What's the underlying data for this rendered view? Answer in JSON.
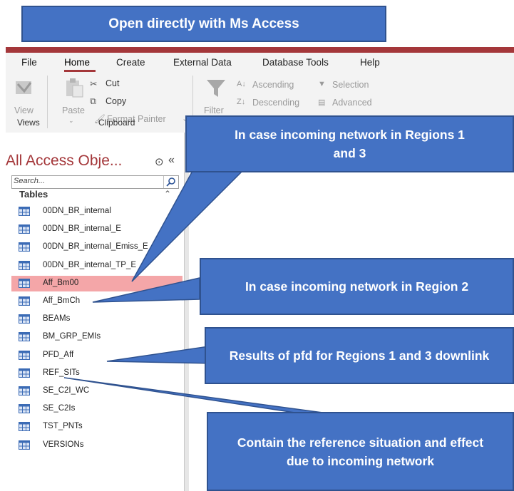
{
  "header_callout": "Open directly with Ms Access",
  "menu": [
    "File",
    "Home",
    "Create",
    "External Data",
    "Database Tools",
    "Help"
  ],
  "ribbon": {
    "view": "View",
    "paste": "Paste",
    "cut": "Cut",
    "copy": "Copy",
    "format_painter": "Format Painter",
    "filter": "Filter",
    "ascending": "Ascending",
    "descending": "Descending",
    "selection": "Selection",
    "advanced": "Advanced",
    "group_views": "Views",
    "group_clipboard": "Clipboard"
  },
  "nav": {
    "title": "All Access Obje...",
    "search_placeholder": "Search...",
    "section": "Tables",
    "tables": [
      "00DN_BR_internal",
      "00DN_BR_internal_E",
      "00DN_BR_internal_Emiss_E",
      "00DN_BR_internal_TP_E",
      "Aff_Bm00",
      "Aff_BmCh",
      "BEAMs",
      "BM_GRP_EMIs",
      "PFD_Aff",
      "REF_SITs",
      "SE_C2I_WC",
      "SE_C2Is",
      "TST_PNTs",
      "VERSIONs"
    ],
    "selected": "Aff_Bm00"
  },
  "callouts": [
    "In case incoming network in Regions 1 and 3",
    "In case incoming network in Region 2",
    "Results of pfd for Regions 1 and 3 downlink",
    "Contain the reference situation and effect due to incoming network"
  ],
  "colors": {
    "access_red": "#a4373a",
    "callout_blue": "#4472c4",
    "selection_pink": "#f4a6a8"
  }
}
